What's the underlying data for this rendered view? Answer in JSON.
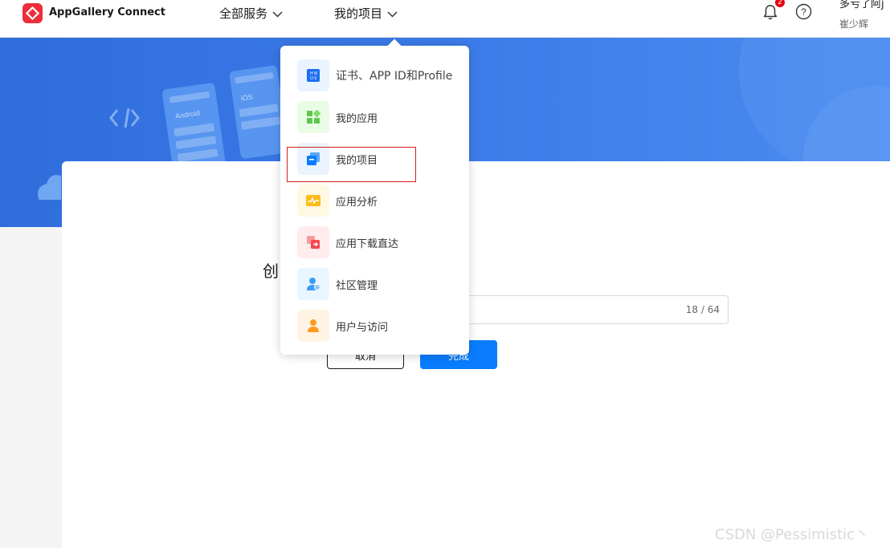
{
  "header": {
    "brand": "AppGallery Connect",
    "nav_all_services": "全部服务",
    "nav_my_projects": "我的项目",
    "notification_count": "2",
    "user_name": "多亏了阿j",
    "user_sub": "崔少辉"
  },
  "banner": {
    "card1_label": "Android",
    "card2_label": "iOS"
  },
  "dropdown": {
    "items": [
      {
        "label": "证书、APP ID和Profile",
        "icon": "certificate-icon",
        "bg": "#eaf4ff"
      },
      {
        "label": "我的应用",
        "icon": "apps-grid-icon",
        "bg": "#eafbe6"
      },
      {
        "label": "我的项目",
        "icon": "project-icon",
        "bg": "#eaf4ff"
      },
      {
        "label": "应用分析",
        "icon": "analytics-icon",
        "bg": "#fff8e3"
      },
      {
        "label": "应用下载直达",
        "icon": "download-icon",
        "bg": "#ffecec"
      },
      {
        "label": "社区管理",
        "icon": "community-icon",
        "bg": "#eaf6ff"
      },
      {
        "label": "用户与访问",
        "icon": "user-access-icon",
        "bg": "#fff3e4"
      }
    ]
  },
  "form": {
    "title": "创",
    "input_count": "18 / 64",
    "cancel": "取消",
    "done": "完成"
  },
  "watermark": "CSDN @Pessimistic丶",
  "colors": {
    "brand_red": "#ee2e3b",
    "primary_blue": "#0a7dfe",
    "banner_blue": "#3b7be8",
    "highlight_red": "#d81e1e"
  }
}
